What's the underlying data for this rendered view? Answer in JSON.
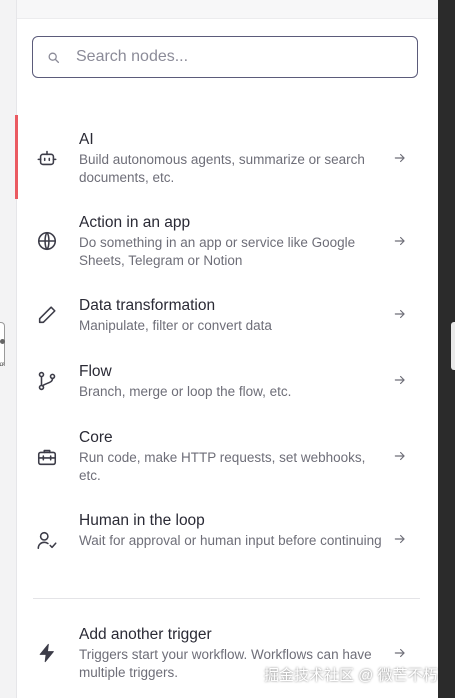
{
  "search": {
    "placeholder": "Search nodes..."
  },
  "categories": [
    {
      "title": "AI",
      "desc": "Build autonomous agents, summarize or search documents, etc.",
      "icon": "bot-icon"
    },
    {
      "title": "Action in an app",
      "desc": "Do something in an app or service like Google Sheets, Telegram or Notion",
      "icon": "globe-icon"
    },
    {
      "title": "Data transformation",
      "desc": "Manipulate, filter or convert data",
      "icon": "pencil-icon"
    },
    {
      "title": "Flow",
      "desc": "Branch, merge or loop the flow, etc.",
      "icon": "git-branch-icon"
    },
    {
      "title": "Core",
      "desc": "Run code, make HTTP requests, set webhooks, etc.",
      "icon": "toolbox-icon"
    },
    {
      "title": "Human in the loop",
      "desc": "Wait for approval or human input before continuing",
      "icon": "user-check-icon"
    }
  ],
  "trigger": {
    "title": "Add another trigger",
    "desc": "Triggers start your workflow. Workflows can have multiple triggers.",
    "icon": "bolt-icon"
  },
  "canvas": {
    "tiny_label": "m"
  },
  "watermark": "掘金技术社区 @ 微芒不朽",
  "colors": {
    "accent": "#ea5a61",
    "border": "#5b5b7a"
  }
}
